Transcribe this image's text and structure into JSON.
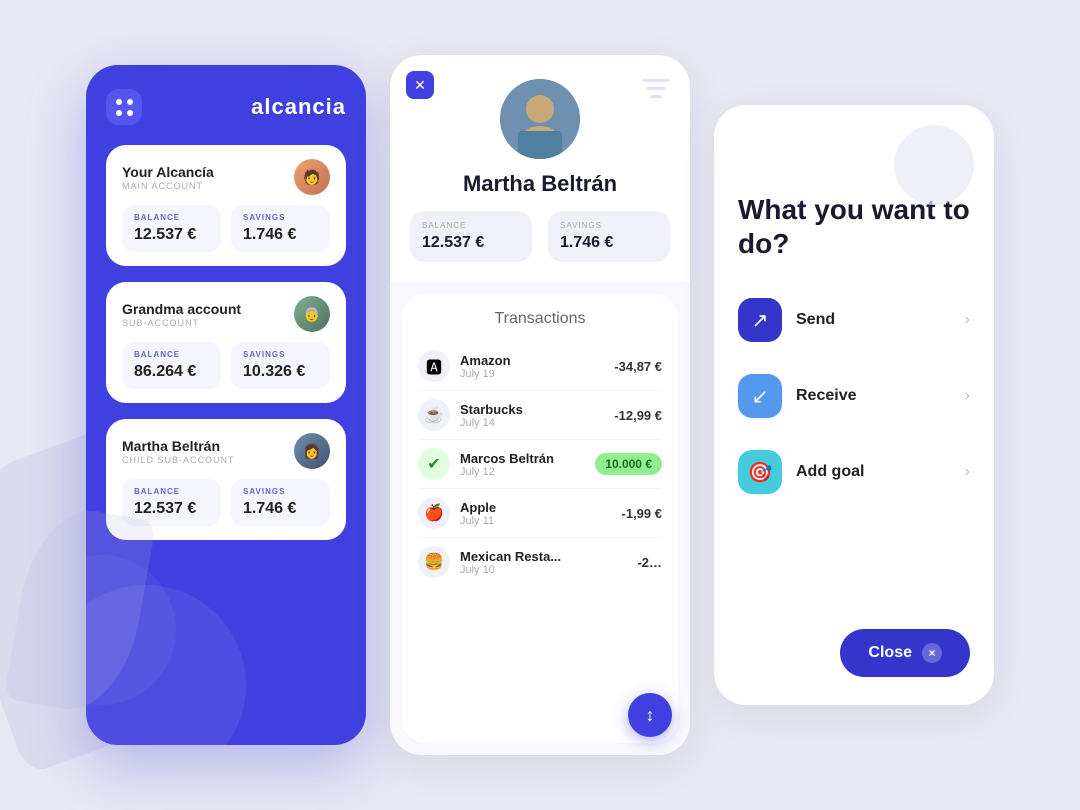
{
  "app": {
    "name": "alcancia",
    "bg_color": "#e8e8f5"
  },
  "panel1": {
    "title": "alcancia",
    "accounts": [
      {
        "name": "Your Alcancía",
        "type": "MAIN ACCOUNT",
        "balance_label": "BALANCE",
        "balance_value": "12.537 €",
        "savings_label": "SAVINGS",
        "savings_value": "1.746 €",
        "avatar_emoji": "👦"
      },
      {
        "name": "Grandma account",
        "type": "SUB-ACCOUNT",
        "balance_label": "BALANCE",
        "balance_value": "86.264 €",
        "savings_label": "SAVINGS",
        "savings_value": "10.326 €",
        "avatar_emoji": "👵"
      },
      {
        "name": "Martha Beltrán",
        "type": "CHILD SUB-ACCOUNT",
        "balance_label": "BALANCE",
        "balance_value": "12.537 €",
        "savings_label": "SAVINGS",
        "savings_value": "1.746 €",
        "avatar_emoji": "👩"
      }
    ]
  },
  "panel2": {
    "profile_name": "Martha Beltrán",
    "balance_label": "BALANCE",
    "balance_value": "12.537 €",
    "savings_label": "SAVINGS",
    "savings_value": "1.746 €",
    "transactions_title": "Transactions",
    "transactions": [
      {
        "name": "Amazon",
        "date": "July 19",
        "amount": "-34,87 €",
        "icon": "🅰",
        "positive": false
      },
      {
        "name": "Starbucks",
        "date": "July 14",
        "amount": "-12,99 €",
        "icon": "☕",
        "positive": false
      },
      {
        "name": "Marcos Beltrán",
        "date": "July 12",
        "amount": "10.000 €",
        "icon": "✔",
        "positive": true
      },
      {
        "name": "Apple",
        "date": "July 11",
        "amount": "-1,99 €",
        "icon": "🍎",
        "positive": false
      },
      {
        "name": "Mexican Resta...",
        "date": "July 10",
        "amount": "-2…",
        "icon": "🍔",
        "positive": false
      }
    ]
  },
  "panel3": {
    "title": "What you want to do?",
    "actions": [
      {
        "label": "Send",
        "icon_class": "send",
        "icon": "↗"
      },
      {
        "label": "Receive",
        "icon_class": "receive",
        "icon": "↙"
      },
      {
        "label": "Add goal",
        "icon_class": "goal",
        "icon": "🎯"
      }
    ],
    "close_label": "Close",
    "close_icon": "×"
  }
}
